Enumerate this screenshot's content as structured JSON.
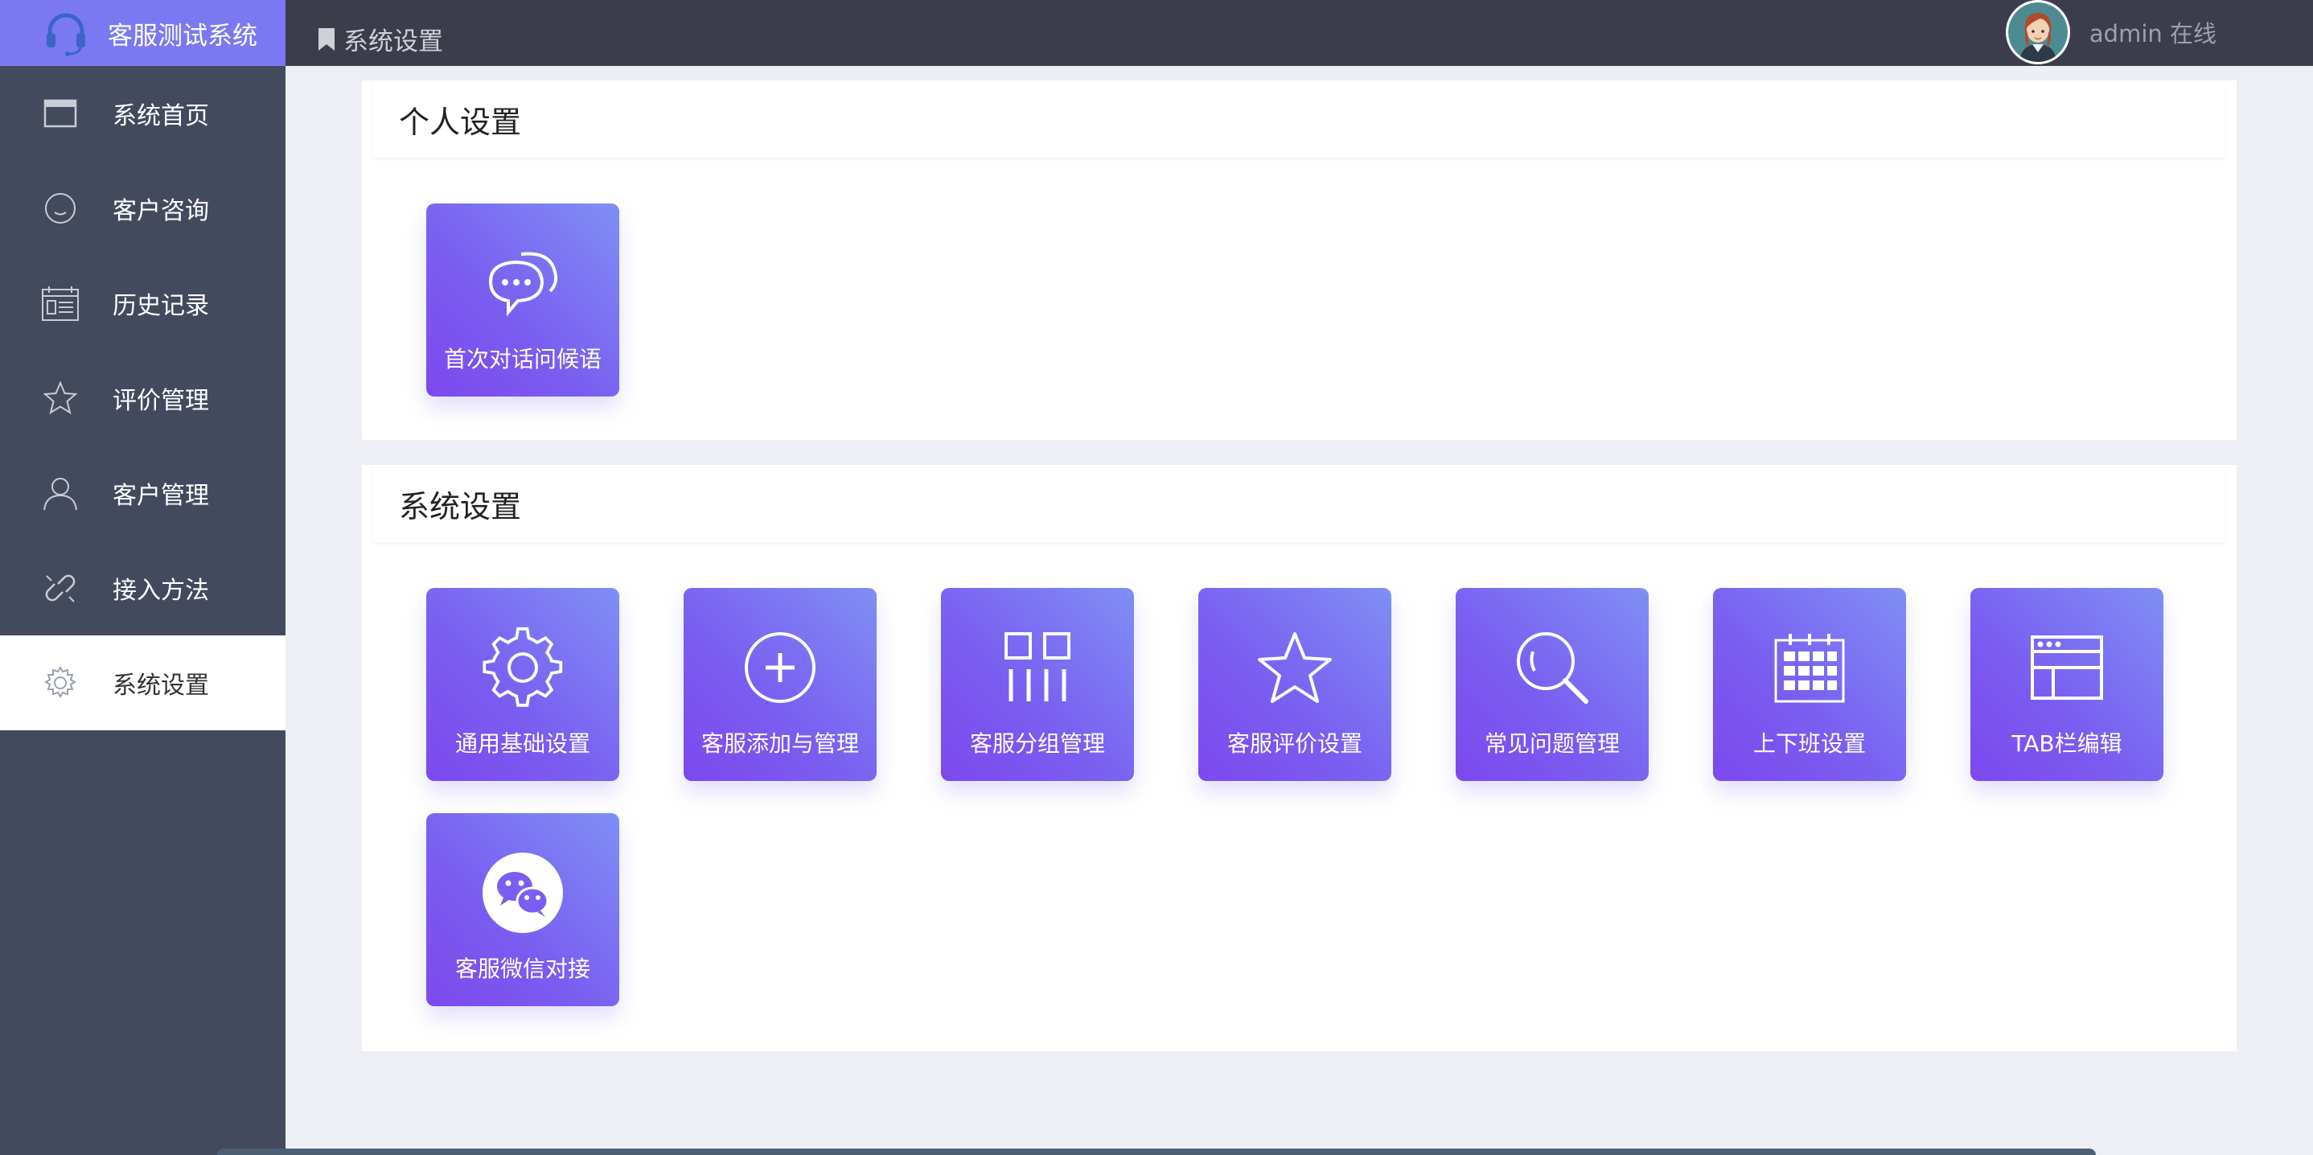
{
  "brand": {
    "name": "客服测试系统"
  },
  "sidebar": {
    "items": [
      {
        "label": "系统首页",
        "icon": "window-icon",
        "active": false
      },
      {
        "label": "客户咨询",
        "icon": "smile-icon",
        "active": false
      },
      {
        "label": "历史记录",
        "icon": "calendar-list-icon",
        "active": false
      },
      {
        "label": "评价管理",
        "icon": "star-icon",
        "active": false
      },
      {
        "label": "客户管理",
        "icon": "user-icon",
        "active": false
      },
      {
        "label": "接入方法",
        "icon": "link-icon",
        "active": false
      },
      {
        "label": "系统设置",
        "icon": "gear-icon",
        "active": true
      }
    ]
  },
  "header": {
    "breadcrumb": "系统设置",
    "user_status": "admin 在线"
  },
  "sections": {
    "personal": {
      "title": "个人设置",
      "tiles": [
        {
          "label": "首次对话问候语",
          "icon": "chat-bubbles-icon"
        }
      ]
    },
    "system": {
      "title": "系统设置",
      "tiles": [
        {
          "label": "通用基础设置",
          "icon": "gear-icon"
        },
        {
          "label": "客服添加与管理",
          "icon": "plus-circle-icon"
        },
        {
          "label": "客服分组管理",
          "icon": "group-grid-icon"
        },
        {
          "label": "客服评价设置",
          "icon": "star-icon"
        },
        {
          "label": "常见问题管理",
          "icon": "search-icon"
        },
        {
          "label": "上下班设置",
          "icon": "calendar-icon"
        },
        {
          "label": "TAB栏编辑",
          "icon": "browser-window-icon"
        },
        {
          "label": "客服微信对接",
          "icon": "wechat-icon"
        }
      ]
    }
  },
  "colors": {
    "sidebar_bg": "#434a5d",
    "brand_bg": "#7b79f2",
    "topbar_bg": "#3b3e4a",
    "tile_gradient_start": "#7f8ff5",
    "tile_gradient_end": "#7d48ee"
  }
}
